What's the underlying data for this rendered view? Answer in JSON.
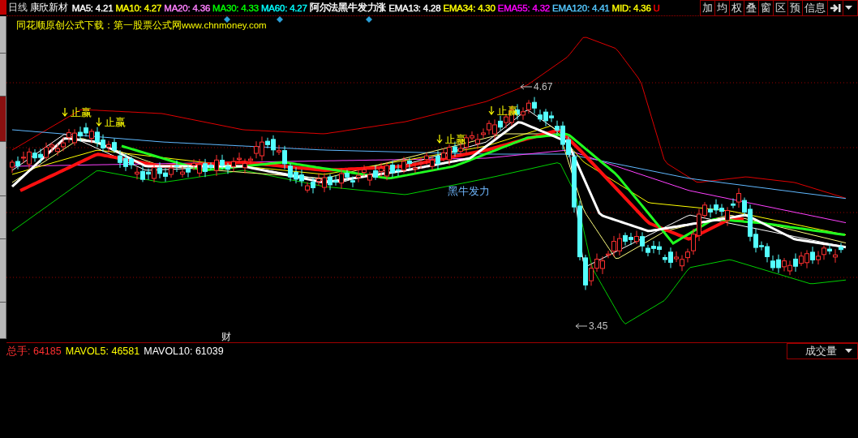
{
  "sidebar_tabs": [
    {
      "selected": false
    },
    {
      "selected": false
    },
    {
      "selected": true
    },
    {
      "selected": false
    },
    {
      "selected": false
    },
    {
      "selected": false
    },
    {
      "selected": false
    }
  ],
  "header": {
    "period": "日线",
    "stock_name": "康欣新材",
    "indicators": [
      {
        "text": "MA5: 4.21",
        "color": "#ffffff"
      },
      {
        "text": "MA10: 4.27",
        "color": "#ffff00"
      },
      {
        "text": "MA20: 4.36",
        "color": "#ff80ff"
      },
      {
        "text": "MA30: 4.33",
        "color": "#00ff00"
      },
      {
        "text": "MA60: 4.27",
        "color": "#00ffff"
      },
      {
        "text": "阿尔法黑牛发力涨",
        "color": "#ffffff"
      },
      {
        "text": "EMA13: 4.28",
        "color": "#ffffff"
      },
      {
        "text": "EMA34: 4.30",
        "color": "#ffff00"
      },
      {
        "text": "EMA55: 4.32",
        "color": "#ff00ff"
      },
      {
        "text": "EMA120: 4.41",
        "color": "#54c8ff"
      },
      {
        "text": "MID: 4.36",
        "color": "#ffff00"
      },
      {
        "text": "U",
        "color": "#ff0000"
      }
    ],
    "buttons": [
      "加",
      "均",
      "权",
      "叠",
      "窗",
      "区",
      "预",
      "信息"
    ]
  },
  "price_panel": {
    "formula_title": "同花顺原创公式下载：第一股票公式网www.chnmoney.com",
    "annotations": [
      {
        "kind": "signal",
        "text": "止赢"
      },
      {
        "kind": "signal",
        "text": "止赢"
      },
      {
        "kind": "signal",
        "text": "止赢"
      },
      {
        "kind": "signal",
        "text": "止赢"
      },
      {
        "kind": "label",
        "text": "黑牛发力"
      },
      {
        "kind": "high",
        "text": "4.67"
      },
      {
        "kind": "low",
        "text": "3.45"
      },
      {
        "kind": "event",
        "text": "财"
      }
    ]
  },
  "volume_panel": {
    "indicators": [
      {
        "text": "总手: 64185",
        "color": "#ff3030"
      },
      {
        "text": "MAVOL5: 46581",
        "color": "#ffff00"
      },
      {
        "text": "MAVOL10: 61039",
        "color": "#ffffff"
      }
    ],
    "selector": "成交量"
  }
}
